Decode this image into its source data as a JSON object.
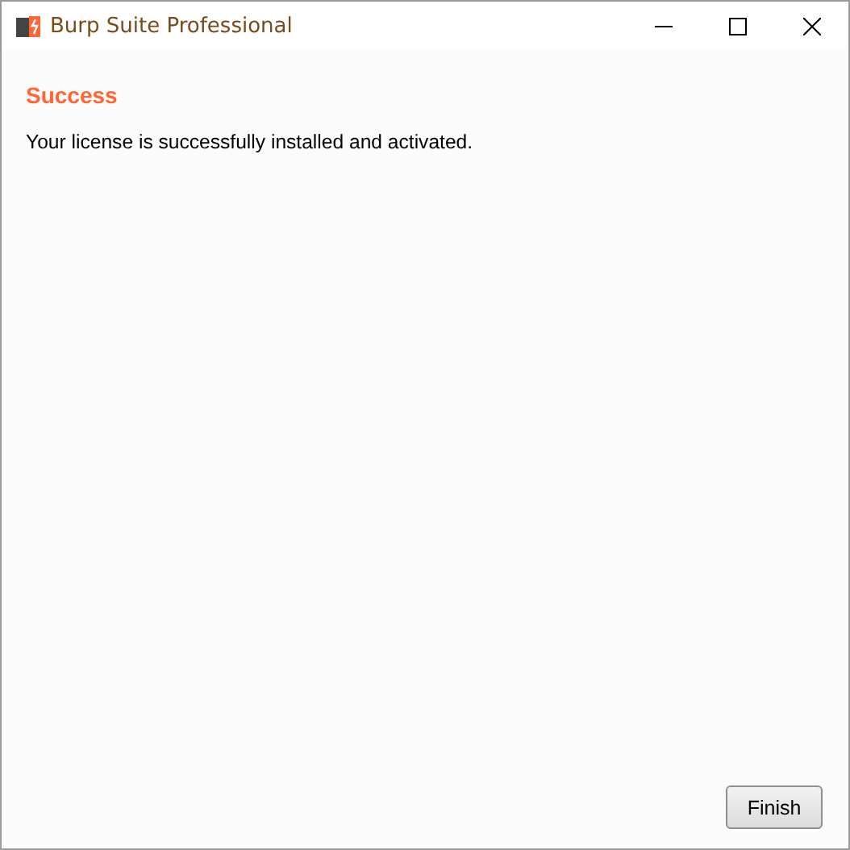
{
  "window": {
    "title": "Burp Suite Professional"
  },
  "heading": "Success",
  "message": "Your license is successfully installed and activated.",
  "buttons": [
    "Finish"
  ]
}
